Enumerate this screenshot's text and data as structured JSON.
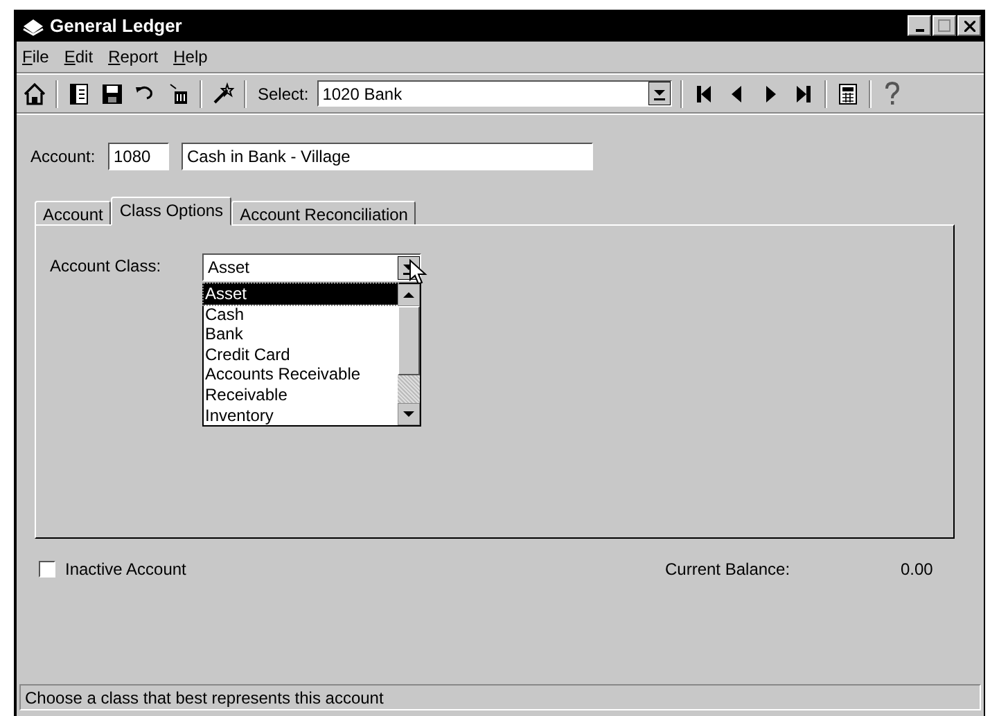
{
  "window": {
    "title": "General Ledger"
  },
  "menu": [
    {
      "label": "File"
    },
    {
      "label": "Edit"
    },
    {
      "label": "Report"
    },
    {
      "label": "Help"
    }
  ],
  "toolbar": {
    "select_label": "Select:",
    "select_value": "1020 Bank"
  },
  "account": {
    "label": "Account:",
    "number": "1080",
    "name": "Cash in Bank - Village"
  },
  "tabs": [
    {
      "label": "Account",
      "selected": false
    },
    {
      "label": "Class Options",
      "selected": true
    },
    {
      "label": "Account Reconciliation",
      "selected": false
    }
  ],
  "account_class": {
    "label": "Account Class:",
    "value": "Asset",
    "expanded": true,
    "options": [
      {
        "label": "Asset",
        "selected": true
      },
      {
        "label": "Cash",
        "selected": false
      },
      {
        "label": "Bank",
        "selected": false
      },
      {
        "label": "Credit Card",
        "selected": false
      },
      {
        "label": "Accounts Receivable",
        "selected": false
      },
      {
        "label": "Receivable",
        "selected": false
      },
      {
        "label": "Inventory",
        "selected": false
      }
    ]
  },
  "inactive_account": {
    "label": "Inactive Account",
    "checked": false
  },
  "current_balance": {
    "label": "Current Balance:",
    "value": "0.00"
  },
  "status_bar": "Choose a class that best represents this account"
}
